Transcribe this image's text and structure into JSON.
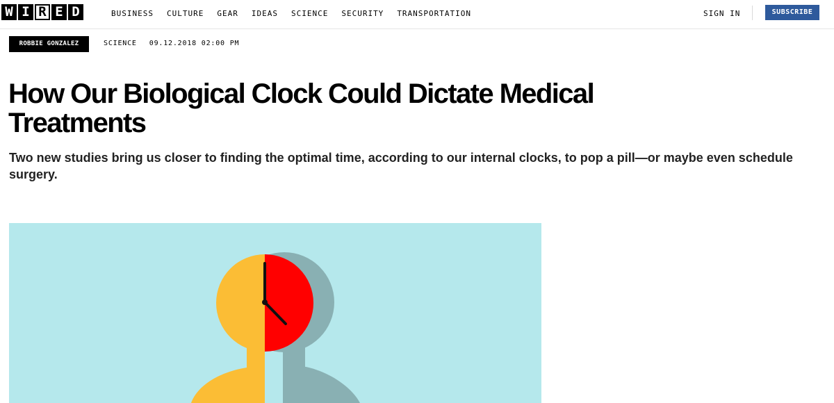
{
  "header": {
    "logo_letters": [
      "W",
      "I",
      "R",
      "E",
      "D"
    ],
    "nav": [
      "BUSINESS",
      "CULTURE",
      "GEAR",
      "IDEAS",
      "SCIENCE",
      "SECURITY",
      "TRANSPORTATION"
    ],
    "sign_in": "SIGN IN",
    "subscribe": "SUBSCRIBE",
    "accent_color": "#2e5a9c"
  },
  "article": {
    "author": "ROBBIE GONZALEZ",
    "section": "SCIENCE",
    "date": "09.12.2018 02:00 PM",
    "title": "How Our Biological Clock Could Dictate Medical Treatments",
    "dek": "Two new studies bring us closer to finding the optimal time, according to our internal clocks, to pop a pill—or maybe even schedule surgery."
  },
  "hero": {
    "background_color": "#b5e8ec",
    "head_left_color": "#fbbd35",
    "head_right_color": "#ff0000",
    "shadow_color": "#89b0b3",
    "clock_hands": "hour-and-minute"
  }
}
